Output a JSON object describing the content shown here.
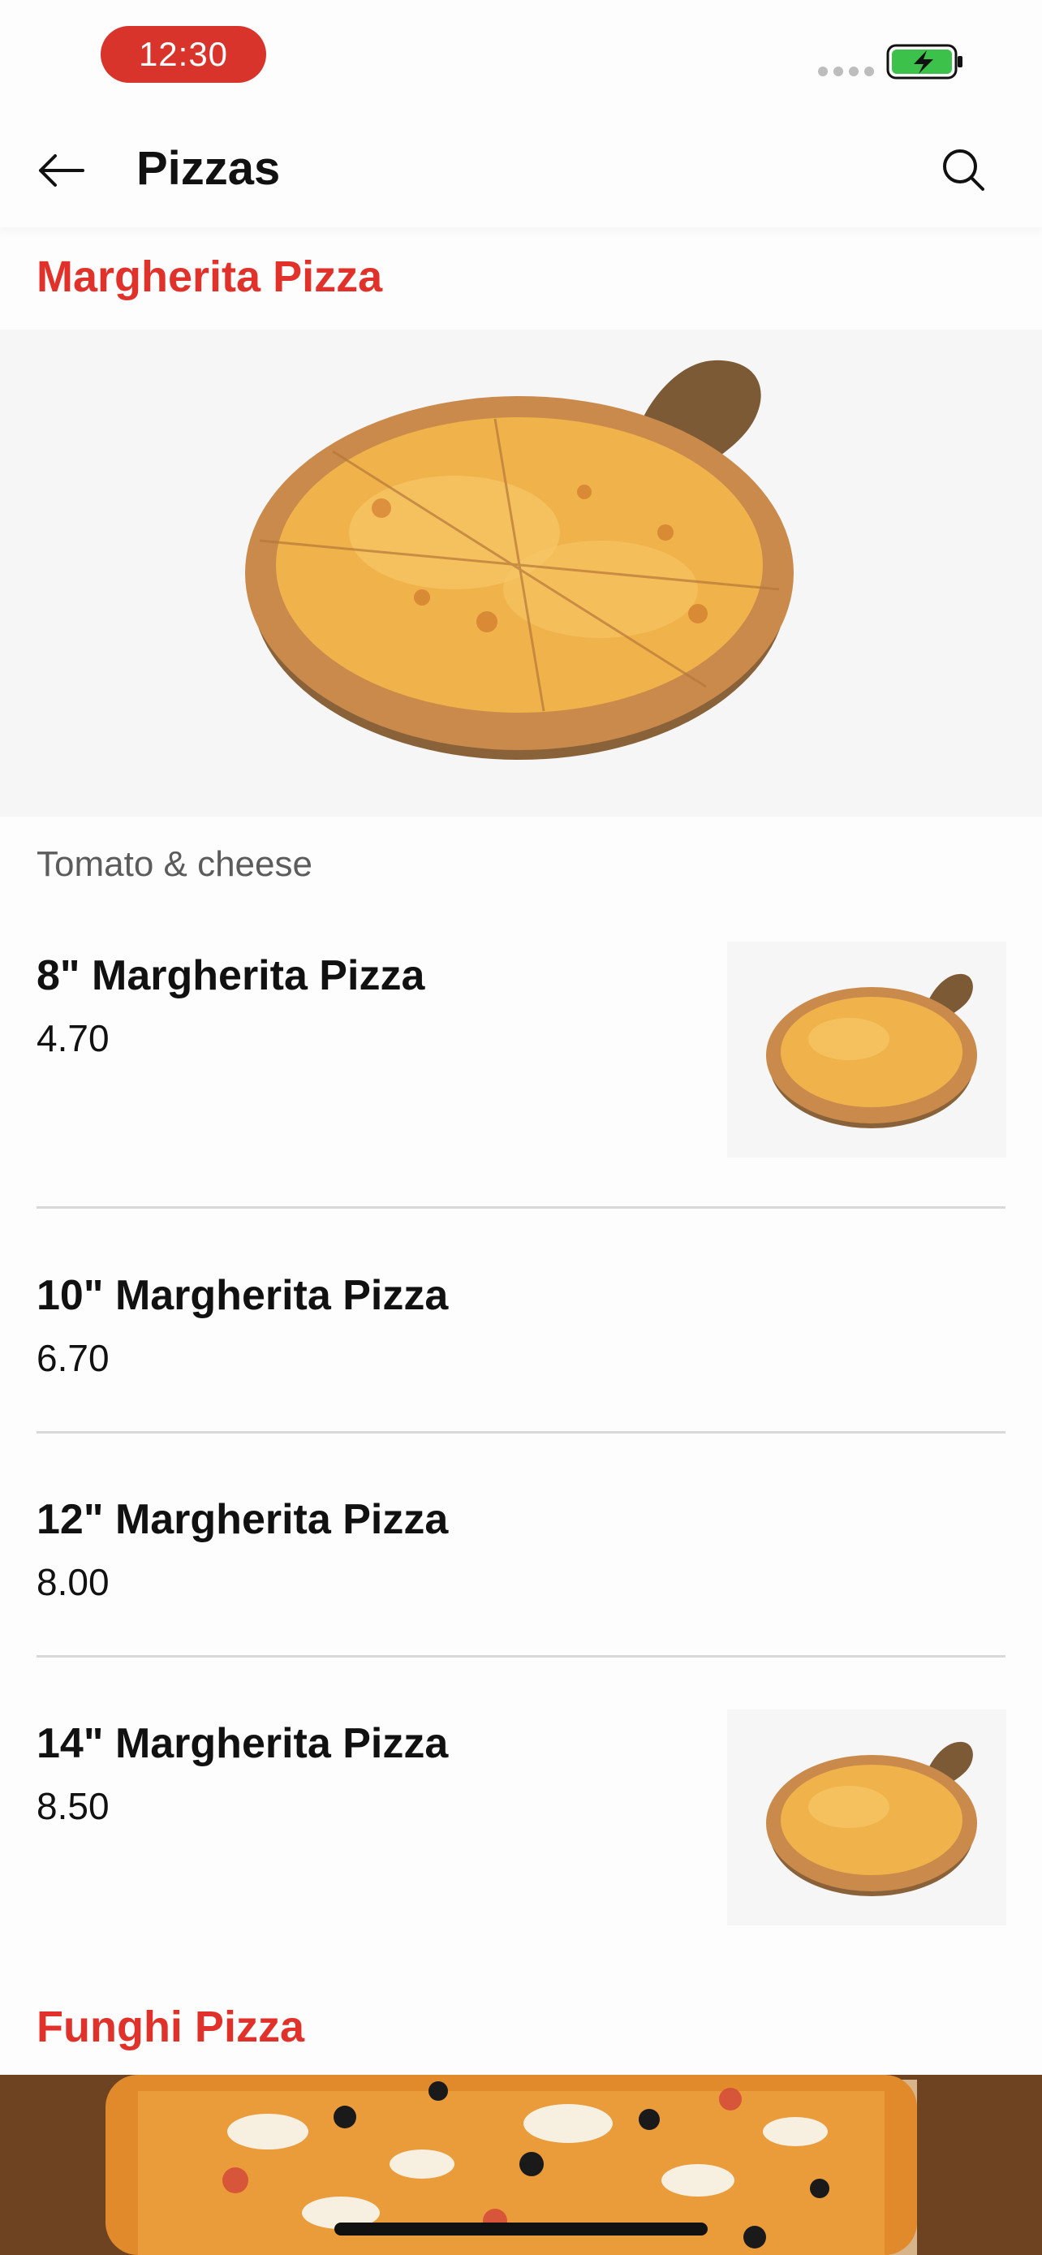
{
  "status_bar": {
    "time": "12:30"
  },
  "nav": {
    "title": "Pizzas"
  },
  "sections": [
    {
      "title": "Margherita Pizza",
      "description": "Tomato & cheese",
      "items": [
        {
          "name": "8\" Margherita Pizza",
          "price": "4.70"
        },
        {
          "name": "10\" Margherita Pizza",
          "price": "6.70"
        },
        {
          "name": "12\" Margherita Pizza",
          "price": "8.00"
        },
        {
          "name": "14\" Margherita Pizza",
          "price": "8.50"
        }
      ]
    },
    {
      "title": "Funghi Pizza"
    }
  ],
  "icons": {
    "back": "arrow-left-icon",
    "search": "search-icon",
    "battery": "battery-charging-icon",
    "signal": "signal-dots-icon"
  },
  "colors": {
    "accent": "#e0322a",
    "time_pill": "#d9342b",
    "battery": "#3cc24a"
  }
}
